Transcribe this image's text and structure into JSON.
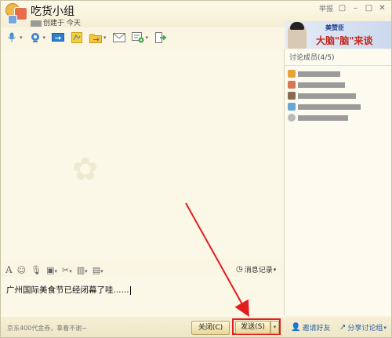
{
  "titlebar": {
    "group_name": "吃货小组",
    "created_text": "创建于 今天",
    "report_label": "举报"
  },
  "toolbar": {
    "icons": [
      "microphone-icon",
      "video-icon",
      "screen-share-icon",
      "whiteboard-icon",
      "folder-icon",
      "mail-icon",
      "apps-icon",
      "exit-icon"
    ]
  },
  "ad": {
    "brand": "美赞臣",
    "slogan": "大脑\"脑\"来谈"
  },
  "members_panel": {
    "title": "讨论成员(4/5)"
  },
  "format_bar": {
    "history_label": "消息记录"
  },
  "input": {
    "value": "广州国际美食节已经闭幕了哇......"
  },
  "bottom": {
    "promo": "京东400代金券，拿着不谢~",
    "close_label": "关闭(C)",
    "send_label": "发送(S)",
    "invite_label": "邀请好友",
    "share_label": "分享讨论组"
  },
  "colors": {
    "highlight": "#e21d1d",
    "window_bg": "#fbf6e4",
    "link": "#2a5fa8"
  }
}
